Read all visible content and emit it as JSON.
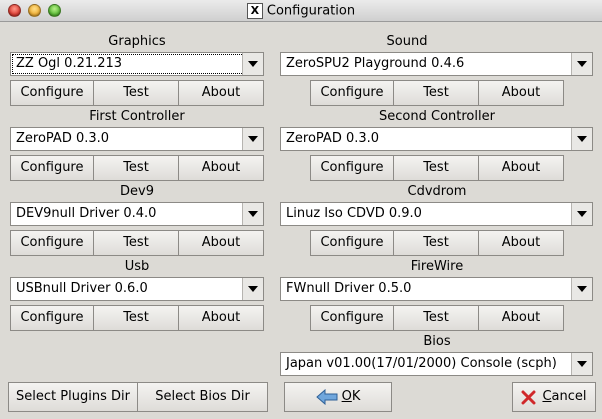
{
  "window": {
    "title": "Configuration",
    "x_icon": "X"
  },
  "buttons": {
    "configure": "Configure",
    "test": "Test",
    "about": "About"
  },
  "left": [
    {
      "label": "Graphics",
      "value": "ZZ Ogl  0.21.213"
    },
    {
      "label": "First Controller",
      "value": "ZeroPAD 0.3.0"
    },
    {
      "label": "Dev9",
      "value": "DEV9null Driver 0.4.0"
    },
    {
      "label": "Usb",
      "value": "USBnull Driver 0.6.0"
    }
  ],
  "right": [
    {
      "label": "Sound",
      "value": "ZeroSPU2 Playground 0.4.6"
    },
    {
      "label": "Second Controller",
      "value": "ZeroPAD 0.3.0"
    },
    {
      "label": "Cdvdrom",
      "value": "Linuz Iso CDVD  0.9.0"
    },
    {
      "label": "FireWire",
      "value": "FWnull Driver 0.5.0"
    }
  ],
  "bios": {
    "label": "Bios",
    "value": "Japan  v01.00(17/01/2000) Console (scph)"
  },
  "footer": {
    "select_plugins": "Select Plugins Dir",
    "select_bios": "Select Bios Dir",
    "ok_mnemonic": "O",
    "ok_rest": "K",
    "cancel_mnemonic": "C",
    "cancel_rest": "ancel"
  }
}
